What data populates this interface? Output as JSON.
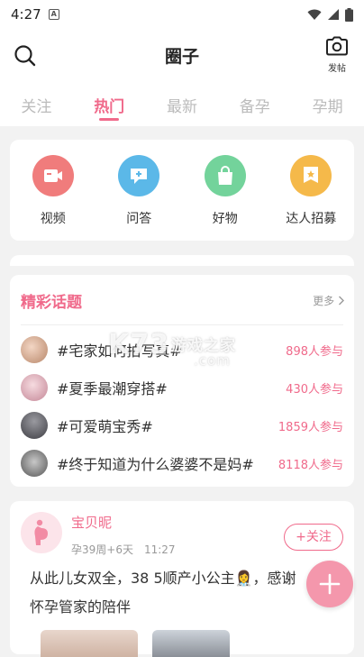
{
  "status_bar": {
    "time": "4:27",
    "notification_glyph": "A"
  },
  "header": {
    "title": "圈子",
    "post_label": "发帖"
  },
  "tabs": [
    {
      "label": "关注",
      "active": false
    },
    {
      "label": "热门",
      "active": true
    },
    {
      "label": "最新",
      "active": false
    },
    {
      "label": "备孕",
      "active": false
    },
    {
      "label": "孕期",
      "active": false
    }
  ],
  "categories": [
    {
      "label": "视频",
      "icon": "video-icon",
      "color": "#f07c7c"
    },
    {
      "label": "问答",
      "icon": "qa-icon",
      "color": "#5bb8e8"
    },
    {
      "label": "好物",
      "icon": "shopping-bag-icon",
      "color": "#73d39b"
    },
    {
      "label": "达人招募",
      "icon": "badge-icon",
      "color": "#f5b94a"
    }
  ],
  "topics": {
    "title": "精彩话题",
    "more_label": "更多",
    "items": [
      {
        "text": "#宅家如何拍写真#",
        "count": "898人参与",
        "avatar_color": "#c9a38a"
      },
      {
        "text": "#夏季最潮穿搭#",
        "count": "430人参与",
        "avatar_color": "#d79aa8"
      },
      {
        "text": "#可爱萌宝秀#",
        "count": "1859人参与",
        "avatar_color": "#6f6f73"
      },
      {
        "text": "#终于知道为什么婆婆不是妈#",
        "count": "8118人参与",
        "avatar_color": "#8a8a8a"
      }
    ]
  },
  "post": {
    "user": "宝贝昵",
    "stage": "孕39周+6天",
    "time": "11:27",
    "follow_label": "+关注",
    "text": "从此儿女双全，38 5顺产小公主👩‍⚕️，感谢怀孕管家的陪伴"
  },
  "watermark": {
    "brand": "K73",
    "cn": "游戏之家",
    "domain": ".com"
  },
  "colors": {
    "accent": "#f06a8b",
    "background": "#f2f2f2"
  }
}
